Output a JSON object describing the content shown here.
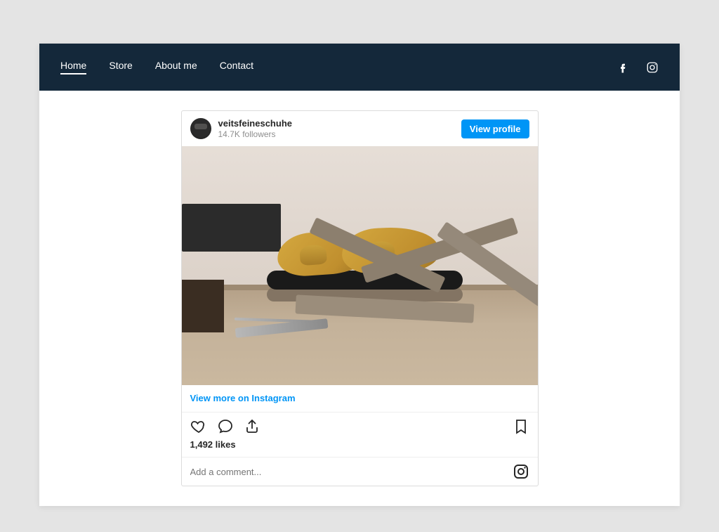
{
  "nav": {
    "items": [
      "Home",
      "Store",
      "About me",
      "Contact"
    ],
    "activeIndex": 0
  },
  "instagram": {
    "username": "veitsfeineschuhe",
    "followers": "14.7K followers",
    "viewProfile": "View profile",
    "viewMore": "View more on Instagram",
    "likes": "1,492 likes",
    "commentPlaceholder": "Add a comment..."
  }
}
